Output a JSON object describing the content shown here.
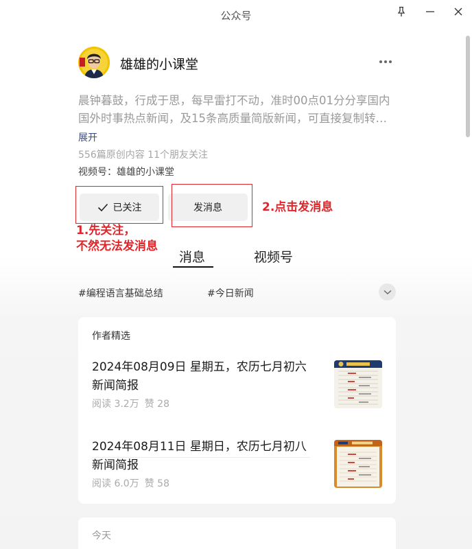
{
  "window": {
    "title": "公众号"
  },
  "account": {
    "name": "雄雄的小课堂",
    "description": "晨钟暮鼓，行成于思，每早雷打不动，准时00点01分分享国内国外时事热点新闻，及15条高质量简版新闻，可直接复制转发。",
    "expand_label": "展开",
    "stats": "556篇原创内容  11个朋友关注",
    "channel": "视频号：雄雄的小课堂"
  },
  "actions": {
    "follow_label": "已关注",
    "message_label": "发消息"
  },
  "annotations": {
    "step1_line1": "1.先关注，",
    "step1_line2": "不然无法发消息",
    "step2": "2.点击发消息",
    "color": "#e0262a"
  },
  "tabs": [
    {
      "label": "消息",
      "active": true
    },
    {
      "label": "视频号",
      "active": false
    }
  ],
  "hashtags": [
    "#编程语言基础总结",
    "#今日新闻"
  ],
  "featured": {
    "heading": "作者精选",
    "articles": [
      {
        "title": "2024年08月09日 星期五，农历七月初六新闻简报",
        "reads": "阅读 3.2万",
        "likes": "赞 28"
      },
      {
        "title": "2024年08月11日 星期日，农历七月初八新闻简报",
        "reads": "阅读 6.0万",
        "likes": "赞 58"
      }
    ]
  },
  "today": {
    "label": "今天"
  },
  "icons": {
    "pin": "pin-icon",
    "minimize": "minimize-icon",
    "close": "close-icon",
    "more": "more-dots-icon",
    "check": "check-icon",
    "chevron": "chevron-down-icon"
  }
}
